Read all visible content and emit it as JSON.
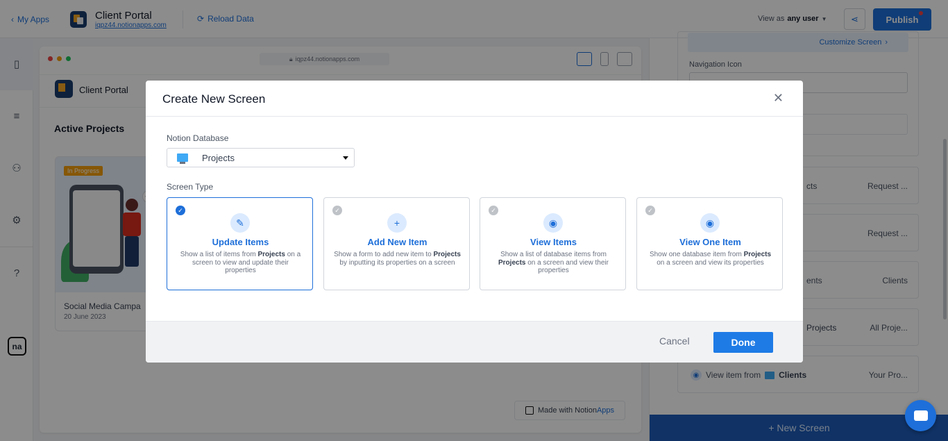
{
  "topbar": {
    "back_label": "My Apps",
    "app_title": "Client Portal",
    "app_url": "iqpz44.notionapps.com",
    "reload_label": "Reload Data",
    "view_as_prefix": "View as",
    "view_as_value": "any user",
    "publish_label": "Publish"
  },
  "preview": {
    "url": "iqpz44.notionapps.com",
    "app_title": "Client Portal",
    "heading": "Active Projects",
    "card": {
      "badge": "In Progress",
      "title": "Social Media Campa",
      "date": "20 June 2023"
    },
    "made_with_prefix": "Made with Notion",
    "made_with_suffix": "Apps"
  },
  "right_panel": {
    "customize_label": "Customize Screen",
    "navigation_icon_label": "Navigation Icon",
    "screens": [
      {
        "left": "cts",
        "right": "Request ..."
      },
      {
        "left": "",
        "right": "Request ..."
      },
      {
        "left": "ents",
        "right": "Clients"
      },
      {
        "left": "Projects",
        "right": "All Proje..."
      },
      {
        "prefix": "View item from",
        "db": "Clients",
        "right": "Your Pro..."
      }
    ],
    "new_screen_label": "+ New Screen"
  },
  "modal": {
    "title": "Create New Screen",
    "database_label": "Notion Database",
    "database_value": "Projects",
    "screen_type_label": "Screen Type",
    "types": [
      {
        "title": "Update Items",
        "desc_pre": "Show a list of items from ",
        "desc_db": "Projects",
        "desc_post": " on a screen to view and update their properties",
        "icon": "pencil-icon",
        "selected": true
      },
      {
        "title": "Add New Item",
        "desc_pre": "Show a form to add new item to ",
        "desc_db": "Projects",
        "desc_post": " by inputting its properties on a screen",
        "icon": "plus-icon",
        "selected": false
      },
      {
        "title": "View Items",
        "desc_pre": "Show a list of database items from ",
        "desc_db": "Projects",
        "desc_post": " on a screen and view their properties",
        "icon": "eye-icon",
        "selected": false
      },
      {
        "title": "View One Item",
        "desc_pre": "Show one database item from ",
        "desc_db": "Projects",
        "desc_post": " on a screen and view its properties",
        "icon": "eye-icon",
        "selected": false
      }
    ],
    "cancel_label": "Cancel",
    "done_label": "Done"
  },
  "colors": {
    "accent": "#1e6fd9",
    "publish": "#1e6fd9",
    "new_screen_bar": "#1e5bb8"
  }
}
